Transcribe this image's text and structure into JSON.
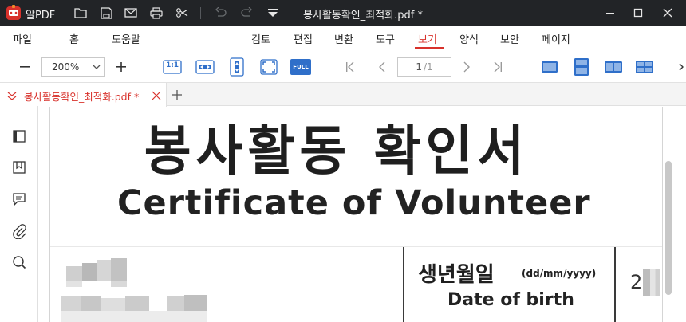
{
  "titlebar": {
    "app_name": "알PDF",
    "doc_title": "봉사활동확인_최적화.pdf *",
    "icons": [
      "app-logo-icon",
      "folder-icon",
      "save-icon",
      "mail-icon",
      "print-icon",
      "scissors-icon",
      "undo-icon",
      "redo-icon",
      "quick-menu-icon"
    ],
    "window_controls": [
      "minimize-icon",
      "maximize-icon",
      "close-icon"
    ]
  },
  "menu": {
    "items": [
      {
        "label": "파일"
      },
      {
        "label": "홈"
      },
      {
        "label": "도움말"
      },
      {
        "label": "검토"
      },
      {
        "label": "편집"
      },
      {
        "label": "변환"
      },
      {
        "label": "도구"
      },
      {
        "label": "보기",
        "active": true
      },
      {
        "label": "양식"
      },
      {
        "label": "보안"
      },
      {
        "label": "페이지"
      }
    ]
  },
  "toolbar": {
    "zoom_out_icon": "minus-icon",
    "zoom_value": "200%",
    "zoom_in_icon": "plus-icon",
    "actual_size_label": "1:1",
    "fit_width_icon": "fit-width-icon",
    "fit_height_icon": "fit-height-icon",
    "fit_page_icon": "fit-page-icon",
    "fullscreen_label": "FULL",
    "current_page": "1",
    "total_pages": "/1",
    "nav_icons": [
      "first-page-icon",
      "prev-page-icon",
      "next-page-icon",
      "last-page-icon"
    ],
    "view_modes": [
      "single-page-icon",
      "continuous-page-icon",
      "two-page-icon",
      "two-page-continuous-icon"
    ],
    "active_view_mode": "continuous-page-icon"
  },
  "tabs": [
    {
      "label": "봉사활동확인_최적화.pdf *",
      "active": true
    }
  ],
  "sidebar": {
    "icons": [
      "panel-toggle-icon",
      "bookmark-icon",
      "comment-icon",
      "attachment-icon",
      "search-icon"
    ]
  },
  "document": {
    "title_ko": "봉사활동 확인서",
    "title_en": "Certificate of Volunteer",
    "dob_label_ko": "생년월일",
    "dob_format": "(dd/mm/yyyy)",
    "dob_label_en": "Date of birth",
    "dob_value_prefix": "2"
  },
  "colors": {
    "titlebar_bg": "#222427",
    "accent": "#d8312b",
    "icon_blue": "#2f6fc9",
    "active_view_bg": "#dde3ec"
  }
}
